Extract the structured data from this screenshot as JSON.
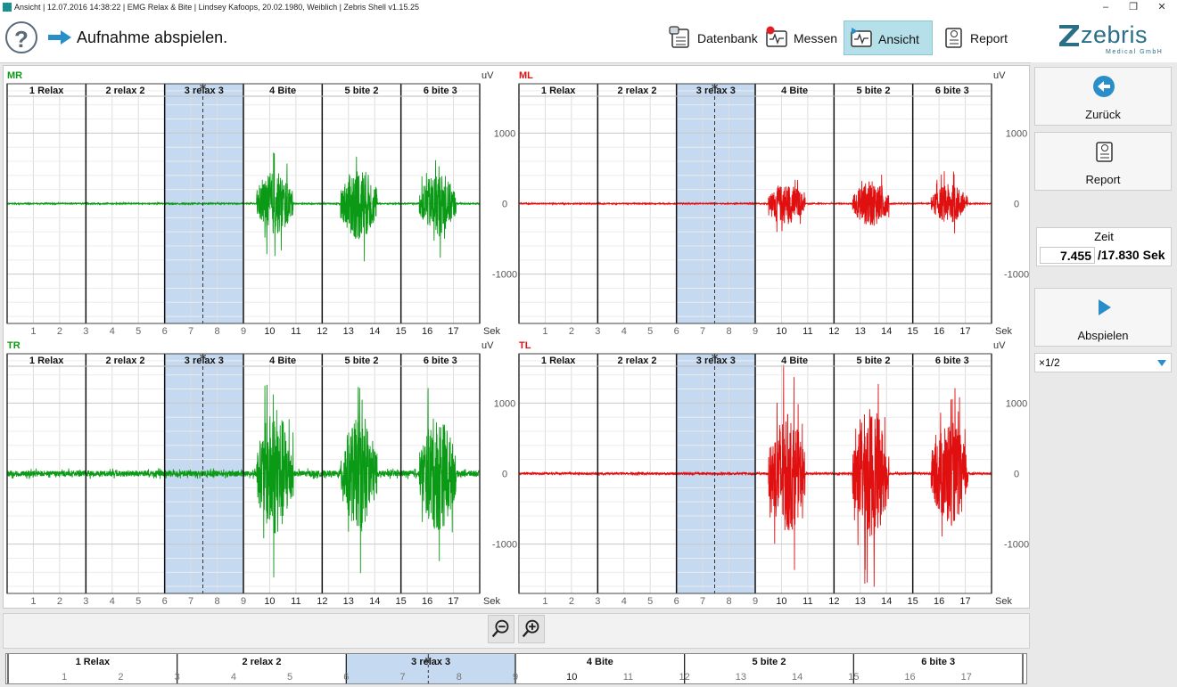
{
  "window": {
    "title": "Ansicht | 12.07.2016 14:38:22 | EMG Relax & Bite | Lindsey Kafoops, 20.02.1980, Weiblich | Zebris Shell v1.15.25",
    "controls": [
      "minimize-icon",
      "restore-icon",
      "close-icon"
    ]
  },
  "header": {
    "help_label": "?",
    "page_title": "Aufnahme abspielen.",
    "nav": [
      {
        "label": "Datenbank",
        "icon": "database-icon",
        "active": false
      },
      {
        "label": "Messen",
        "icon": "measure-icon",
        "active": false
      },
      {
        "label": "Ansicht",
        "icon": "view-icon",
        "active": true
      },
      {
        "label": "Report",
        "icon": "report-icon",
        "active": false
      }
    ],
    "logo_text": "zebris",
    "logo_sub": "Medical GmbH"
  },
  "colors": {
    "green": "#0b9a16",
    "red": "#e01010",
    "highlight": "#c5d9f1",
    "accent": "#2a8fc8"
  },
  "segments": [
    "1 Relax",
    "2 relax 2",
    "3 relax 3",
    "4 Bite",
    "5 bite 2",
    "6 bite 3"
  ],
  "chart_data": [
    {
      "type": "line",
      "title": "MR",
      "color": "#0b9a16",
      "yunit": "uV",
      "xunit": "Sek",
      "ylim": [
        -1700,
        1700
      ],
      "xlim": [
        0,
        18
      ],
      "yticks": [
        1000,
        0,
        -1000
      ],
      "xticks": [
        1,
        2,
        3,
        4,
        5,
        6,
        7,
        8,
        9,
        10,
        11,
        12,
        13,
        14,
        15,
        16,
        17
      ],
      "baseline_noise": 12,
      "bursts": [
        {
          "start": 9.5,
          "end": 10.9,
          "amplitude": 600
        },
        {
          "start": 12.7,
          "end": 14.1,
          "amplitude": 700
        },
        {
          "start": 15.7,
          "end": 17.1,
          "amplitude": 580
        }
      ],
      "selected_range": [
        6,
        9
      ],
      "cursor": 7.455
    },
    {
      "type": "line",
      "title": "ML",
      "color": "#e01010",
      "yunit": "uV",
      "xunit": "Sek",
      "ylim": [
        -1700,
        1700
      ],
      "xlim": [
        0,
        18
      ],
      "yticks": [
        1000,
        0,
        -1000
      ],
      "xticks": [
        1,
        2,
        3,
        4,
        5,
        6,
        7,
        8,
        9,
        10,
        11,
        12,
        13,
        14,
        15,
        16,
        17
      ],
      "baseline_noise": 10,
      "bursts": [
        {
          "start": 9.5,
          "end": 10.9,
          "amplitude": 380
        },
        {
          "start": 12.7,
          "end": 14.1,
          "amplitude": 430
        },
        {
          "start": 15.7,
          "end": 17.1,
          "amplitude": 370
        }
      ],
      "selected_range": [
        6,
        9
      ],
      "cursor": 7.455
    },
    {
      "type": "line",
      "title": "TR",
      "color": "#0b9a16",
      "yunit": "uV",
      "xunit": "Sek",
      "ylim": [
        -1700,
        1700
      ],
      "xlim": [
        0,
        18
      ],
      "yticks": [
        1000,
        0,
        -1000
      ],
      "xticks": [
        1,
        2,
        3,
        4,
        5,
        6,
        7,
        8,
        9,
        10,
        11,
        12,
        13,
        14,
        15,
        16,
        17
      ],
      "baseline_noise": 55,
      "bursts": [
        {
          "start": 9.5,
          "end": 10.9,
          "amplitude": 1200
        },
        {
          "start": 12.7,
          "end": 14.1,
          "amplitude": 1050
        },
        {
          "start": 15.7,
          "end": 17.1,
          "amplitude": 1100
        }
      ],
      "selected_range": [
        6,
        9
      ],
      "cursor": 7.455
    },
    {
      "type": "line",
      "title": "TL",
      "color": "#e01010",
      "yunit": "uV",
      "xunit": "Sek",
      "ylim": [
        -1700,
        1700
      ],
      "xlim": [
        0,
        18
      ],
      "yticks": [
        1000,
        0,
        -1000
      ],
      "xticks": [
        1,
        2,
        3,
        4,
        5,
        6,
        7,
        8,
        9,
        10,
        11,
        12,
        13,
        14,
        15,
        16,
        17
      ],
      "baseline_noise": 20,
      "bursts": [
        {
          "start": 9.5,
          "end": 10.9,
          "amplitude": 1150
        },
        {
          "start": 12.7,
          "end": 14.1,
          "amplitude": 1250
        },
        {
          "start": 15.7,
          "end": 17.1,
          "amplitude": 1000
        }
      ],
      "selected_range": [
        6,
        9
      ],
      "cursor": 7.455
    }
  ],
  "sidebar": {
    "back_label": "Zurück",
    "report_label": "Report",
    "time_label": "Zeit",
    "time_current": "7.455",
    "time_total": "/17.830 Sek",
    "play_label": "Abspielen",
    "speed_value": "×1/2"
  },
  "zoom": {
    "zoom_out_icon": "zoom-out-icon",
    "zoom_in_icon": "zoom-in-icon"
  },
  "timeline": {
    "segments": [
      "1 Relax",
      "2 relax 2",
      "3 relax 3",
      "4 Bite",
      "5 bite 2",
      "6 bite 3"
    ],
    "ticks": [
      1,
      2,
      3,
      4,
      5,
      6,
      7,
      8,
      9,
      10,
      11,
      12,
      13,
      14,
      15,
      16,
      17
    ],
    "selected_range": [
      6,
      9
    ],
    "cursor": 7.455
  }
}
